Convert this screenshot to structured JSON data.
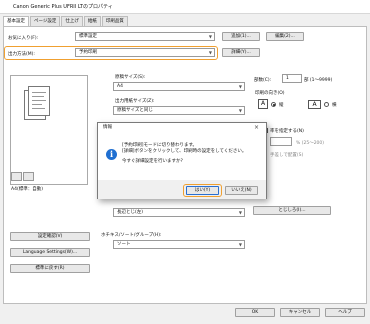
{
  "window": {
    "title": "Canon Generic Plus UFRII LTのプロパティ"
  },
  "tabs": [
    {
      "label": "基本設定"
    },
    {
      "label": "ページ設定"
    },
    {
      "label": "仕上げ"
    },
    {
      "label": "給紙"
    },
    {
      "label": "印刷品質"
    }
  ],
  "favorites": {
    "label": "お気に入り(F):",
    "value": "標準設定",
    "add_button": "追加(1)...",
    "edit_button": "編集(2)..."
  },
  "output_method": {
    "label": "出力方法(M):",
    "value": "予約印刷",
    "detail_button": "詳細(Y)..."
  },
  "preview": {
    "caption": "A4(標準：自動)"
  },
  "paper": {
    "size_label": "原稿サイズ(S):",
    "size_value": "A4",
    "output_size_label": "出力用紙サイズ(Z):",
    "output_size_value": "原稿サイズと同じ"
  },
  "copies": {
    "label": "部数(C):",
    "value": "1",
    "range": "部 (1～9999)"
  },
  "orientation": {
    "label": "印刷の向き(O)",
    "portrait": "縦",
    "landscape": "横",
    "portrait_letter": "A",
    "landscape_letter": "A"
  },
  "scale": {
    "label": "率を指定する(N)",
    "range": "% (25～200)",
    "manual_label": "手差しで配置(S)"
  },
  "binding": {
    "value": "長辺とじ(左)",
    "detail_button": "とじしろ(I)..."
  },
  "staple": {
    "label": "ホチキス/ソート/グループ(H):",
    "value": "ソート"
  },
  "left_buttons": {
    "confirm": "設定確認(V)",
    "language": "Language Settings(W)...",
    "restore": "標準に戻す(R)"
  },
  "footer": {
    "ok": "OK",
    "cancel": "キャンセル",
    "help": "ヘルプ"
  },
  "dialog": {
    "title": "情報",
    "line1": "[予約印刷]モードに切り替わります。",
    "line2": "[詳細]ボタンをクリックして、印刷時の設定をしてください。",
    "line3": "今すぐ詳細設定を行いますか?",
    "yes": "はい(Y)",
    "no": "いいえ(N)"
  },
  "colors": {
    "highlight": "#f0a030",
    "info_icon": "#1f6fd1"
  }
}
